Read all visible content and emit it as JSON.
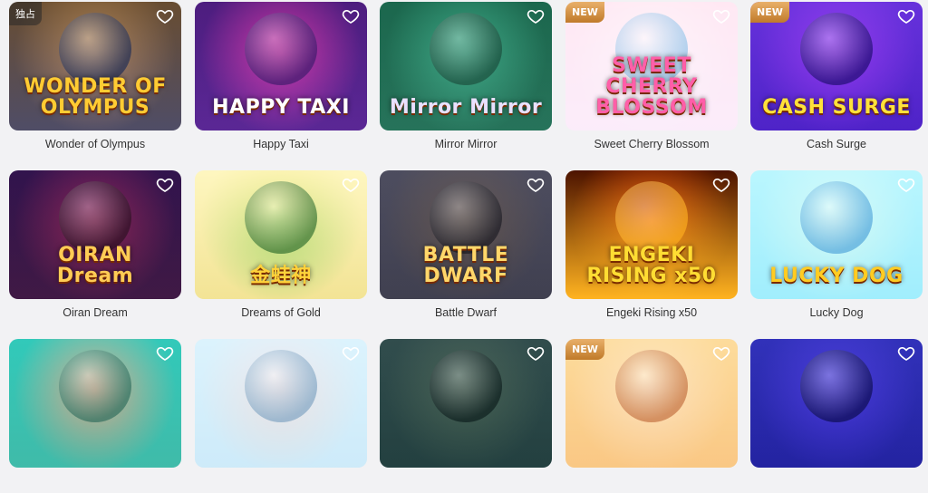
{
  "games": [
    {
      "title": "Wonder of Olympus",
      "logo": "WONDER OF OLYMPUS",
      "badge": "独占",
      "badge_type": "excl",
      "bg": [
        "#3b2a1a",
        "#9a6b3a",
        "#1a2a55"
      ],
      "logo_color": "#ffcc33"
    },
    {
      "title": "Happy Taxi",
      "logo": "HAPPY TAXI",
      "badge": "",
      "badge_type": "",
      "bg": [
        "#2a0f4a",
        "#c0287a",
        "#3a1a6a"
      ],
      "logo_color": "#ffffff"
    },
    {
      "title": "Mirror Mirror",
      "logo": "Mirror Mirror",
      "badge": "",
      "badge_type": "",
      "bg": [
        "#0e3a2a",
        "#2f8a6a",
        "#1a4a3a"
      ],
      "logo_color": "#e9e0ff"
    },
    {
      "title": "Sweet Cherry Blossom",
      "logo": "SWEET CHERRY BLOSSOM",
      "badge": "NEW",
      "badge_type": "new",
      "bg": [
        "#f7b3c8",
        "#f3d6e0",
        "#8ac0e8"
      ],
      "logo_color": "#ff5ea8"
    },
    {
      "title": "Cash Surge",
      "logo": "CASH SURGE",
      "badge": "NEW",
      "badge_type": "new",
      "bg": [
        "#3a1aa0",
        "#7a2ad8",
        "#1a0a6a"
      ],
      "logo_color": "#ffe23a"
    },
    {
      "title": "Oiran Dream",
      "logo": "OIRAN Dream",
      "badge": "",
      "badge_type": "",
      "bg": [
        "#1a0a2a",
        "#7a1a3a",
        "#2a1020"
      ],
      "logo_color": "#ffcc55"
    },
    {
      "title": "Dreams of Gold",
      "logo": "金蛙神",
      "badge": "",
      "badge_type": "",
      "bg": [
        "#f0d080",
        "#6aaa3a",
        "#2a6a2a"
      ],
      "logo_color": "#ffd23a"
    },
    {
      "title": "Battle Dwarf",
      "logo": "BATTLE DWARF",
      "badge": "",
      "badge_type": "",
      "bg": [
        "#2a2a35",
        "#4a3a2a",
        "#1a1a22"
      ],
      "logo_color": "#ffd76a"
    },
    {
      "title": "Engeki Rising x50",
      "logo": "ENGEKI RISING x50",
      "badge": "",
      "badge_type": "",
      "bg": [
        "#2a0a00",
        "#e04a0a",
        "#ffb020"
      ],
      "logo_color": "#ffdd33"
    },
    {
      "title": "Lucky Dog",
      "logo": "LUCKY DOG",
      "badge": "",
      "badge_type": "",
      "bg": [
        "#7ad0f0",
        "#b8e8a0",
        "#4aa0d8"
      ],
      "logo_color": "#ffcc22"
    },
    {
      "title": "",
      "logo": "",
      "badge": "",
      "badge_type": "",
      "bg": [
        "#1a8a7a",
        "#d05a3a",
        "#2a6a5a"
      ],
      "logo_color": "#ffd23a"
    },
    {
      "title": "",
      "logo": "",
      "badge": "",
      "badge_type": "",
      "bg": [
        "#a0c8e8",
        "#d8a060",
        "#7aa0c0"
      ],
      "logo_color": "#ffd23a"
    },
    {
      "title": "",
      "logo": "",
      "badge": "",
      "badge_type": "",
      "bg": [
        "#1a2a2a",
        "#3a4a3a",
        "#0a1a1a"
      ],
      "logo_color": "#ffd23a"
    },
    {
      "title": "",
      "logo": "",
      "badge": "NEW",
      "badge_type": "new",
      "bg": [
        "#e8a060",
        "#f0c0a0",
        "#c06a3a"
      ],
      "logo_color": "#ffd23a"
    },
    {
      "title": "",
      "logo": "",
      "badge": "",
      "badge_type": "",
      "bg": [
        "#1a1a7a",
        "#3a2ac0",
        "#0a0a4a"
      ],
      "logo_color": "#ffd23a"
    }
  ],
  "heart_icon": "heart-outline-icon",
  "text_color": "#333333",
  "background": "#f2f2f4"
}
